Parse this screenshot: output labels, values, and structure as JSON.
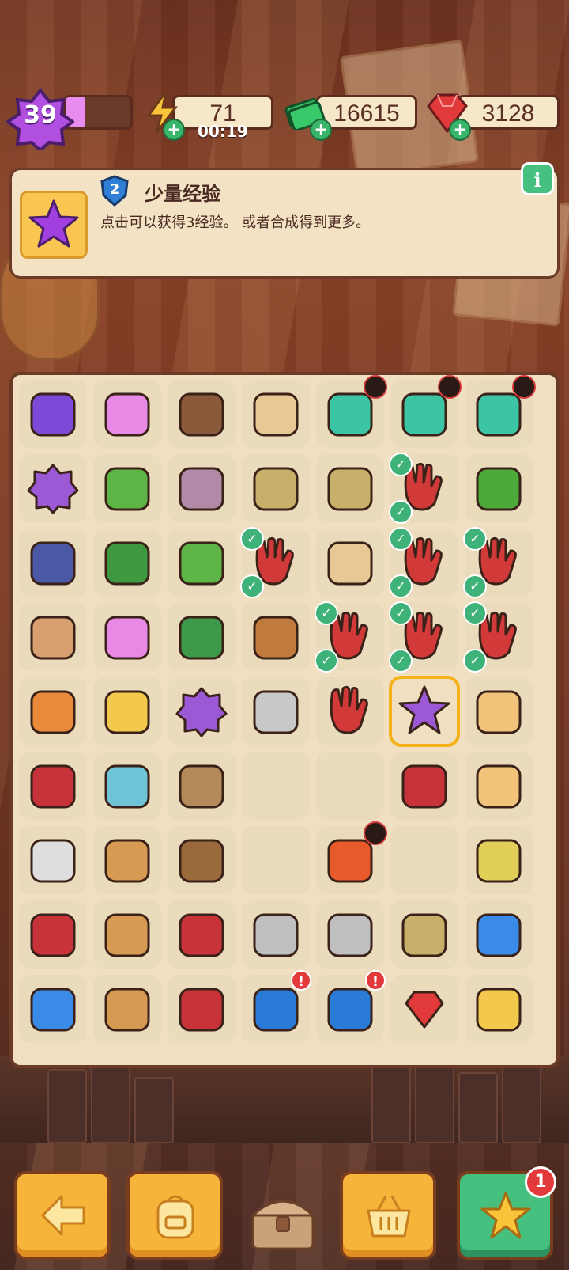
{
  "hud": {
    "level": "39",
    "xp_progress": 0.3,
    "energy": "71",
    "energy_timer": "00:19",
    "cash": "16615",
    "gems": "3128"
  },
  "info_panel": {
    "item_level": "2",
    "title": "少量经验",
    "description": "点击可以获得3经验。 或者合成得到更多。",
    "info_icon": "i"
  },
  "board": {
    "rows": 9,
    "cols": 7,
    "items": [
      [
        "atv-icon",
        "flower-tree-icon",
        "paper-bags-icon",
        "box-icon",
        "medkit-icon-locked",
        "medkit-icon-locked",
        "medkit-icon-locked"
      ],
      [
        "purple-car-icon",
        "sprout-pot-icon",
        "seeds-icon",
        "seed-pack-icon",
        "seed-pack-stack-icon",
        "glove-pair-icon-checked",
        "watering-hose-icon"
      ],
      [
        "jeep-icon",
        "plant-pot-icon",
        "sprout-icon",
        "glove-pair-icon-checked",
        "box-label-icon",
        "glove-pair-icon-checked",
        "glove-pair-icon-checked"
      ],
      [
        "pet-shop-icon",
        "flower-pot-icon",
        "bonsai-icon",
        "capybara-bath-icon",
        "glove-pair-icon-checked",
        "glove-pair-icon-checked",
        "glove-pair-icon-checked"
      ],
      [
        "vending-machine-icon",
        "pool-icon",
        "purple-xp-blob-icon",
        "trowel-icon",
        "glove-icon",
        "purple-star-icon-selected",
        "sandbags-icon"
      ],
      [
        "red-bag-icon",
        "fountain-icon",
        "empty-pot-icon",
        "empty",
        "empty",
        "pruner-icon",
        "sandbags-small-icon"
      ],
      [
        "toolbox-white-icon",
        "pottery-crate-icon",
        "soil-pot-icon",
        "empty",
        "lantern-icon-locked",
        "empty",
        "money-bag-icon"
      ],
      [
        "red-toolbox-icon",
        "pottery-stack-icon",
        "red-case-icon",
        "rake-icon",
        "rake-icon",
        "seed-packet-icon",
        "energy-drink-icon"
      ],
      [
        "energy-crate-icon",
        "pottery-crate-icon",
        "red-case-icon",
        "treasure-chest-icon-alert",
        "treasure-chest-icon-alert",
        "ruby-icon",
        "sunglasses-icon"
      ]
    ]
  },
  "bottom_bar": {
    "back": "back-arrow-icon",
    "backpack": "backpack-icon",
    "chest": "treasure-chest-icon",
    "basket": "basket-icon",
    "rewards": "star-icon",
    "rewards_badge": "1"
  },
  "colors": {
    "accent_orange": "#f7b43a",
    "accent_green": "#46c07e",
    "panel": "#f3e2c4",
    "border": "#6b3b27"
  }
}
